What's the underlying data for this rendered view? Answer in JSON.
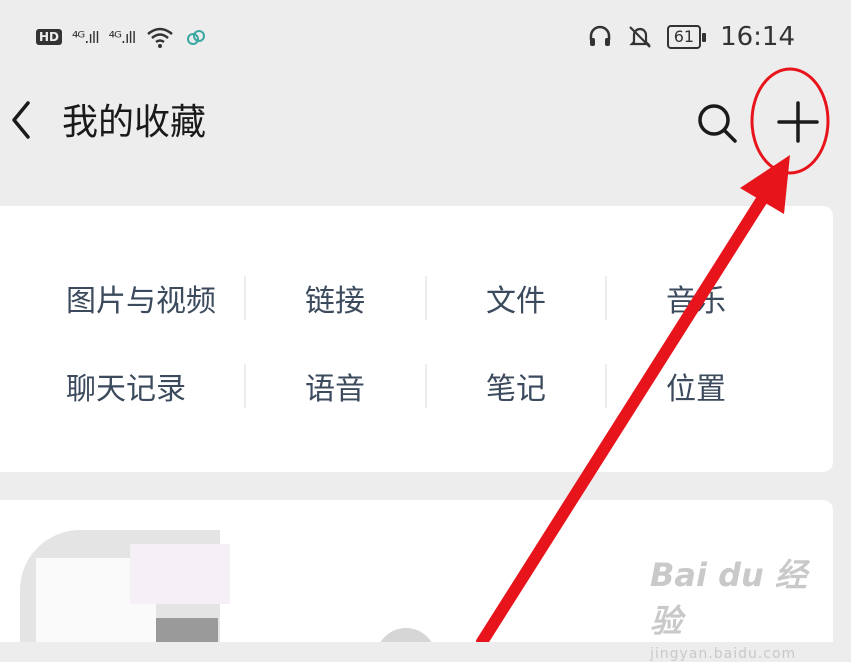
{
  "status_bar": {
    "hd_label": "HD",
    "signal_1": "⁴ᴳ.ıll",
    "signal_2": "⁴ᴳ.ıll",
    "battery": "61",
    "time": "16:14"
  },
  "nav": {
    "title": "我的收藏",
    "back_icon": "chevron-left-icon",
    "search_icon": "search-icon",
    "add_icon": "plus-icon"
  },
  "categories": [
    {
      "label": "图片与视频"
    },
    {
      "label": "链接"
    },
    {
      "label": "文件"
    },
    {
      "label": "音乐"
    },
    {
      "label": "聊天记录"
    },
    {
      "label": "语音"
    },
    {
      "label": "笔记"
    },
    {
      "label": "位置"
    }
  ],
  "watermark": {
    "main": "Bai du 经验",
    "sub": "jingyan.baidu.com"
  },
  "colors": {
    "background": "#ededed",
    "card": "#ffffff",
    "category_text": "#3b4a5c",
    "annotation": "#e8141b"
  }
}
